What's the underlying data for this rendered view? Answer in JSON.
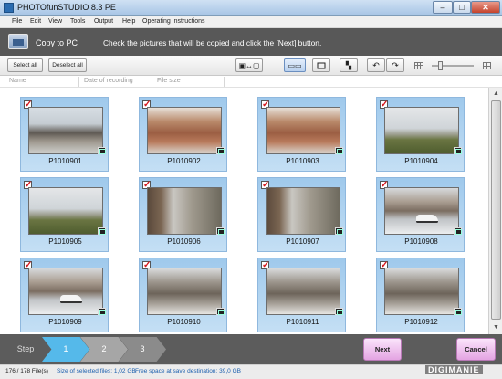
{
  "window": {
    "title": "PHOTOfunSTUDIO 8.3 PE",
    "controls": {
      "minimize": "–",
      "maximize": "□",
      "close": "✕"
    }
  },
  "menu": {
    "items": [
      "File",
      "Edit",
      "View",
      "Tools",
      "Output",
      "Help",
      "Operating Instructions"
    ]
  },
  "header": {
    "title": "Copy to PC",
    "instruction": "Check the pictures that will be copied and click the [Next] button."
  },
  "toolbar": {
    "select_all": "Select all",
    "deselect_all": "Deselect all",
    "icons": [
      "view-toggle-icon",
      "thumbnail-view-icon",
      "single-view-icon",
      "filmstrip-view-icon",
      "rotate-left-icon",
      "rotate-right-icon",
      "small-grid-icon",
      "large-grid-icon"
    ]
  },
  "columns": [
    "Name",
    "Date of recording",
    "File size"
  ],
  "photos": [
    {
      "name": "P1010901",
      "checked": true,
      "style": "lane"
    },
    {
      "name": "P1010902",
      "checked": true,
      "style": "autumn"
    },
    {
      "name": "P1010903",
      "checked": true,
      "style": "autumn"
    },
    {
      "name": "P1010904",
      "checked": true,
      "style": "field"
    },
    {
      "name": "P1010905",
      "checked": true,
      "style": "field"
    },
    {
      "name": "P1010906",
      "checked": true,
      "style": "woodedge"
    },
    {
      "name": "P1010907",
      "checked": true,
      "style": "woodedge"
    },
    {
      "name": "P1010908",
      "checked": true,
      "style": "car"
    },
    {
      "name": "P1010909",
      "checked": true,
      "style": "car"
    },
    {
      "name": "P1010910",
      "checked": true,
      "style": "forest"
    },
    {
      "name": "P1010911",
      "checked": true,
      "style": "forest"
    },
    {
      "name": "P1010912",
      "checked": true,
      "style": "forest"
    }
  ],
  "steps": {
    "label": "Step",
    "items": [
      "1",
      "2",
      "3"
    ],
    "active": "1"
  },
  "actions": {
    "next": "Next",
    "cancel": "Cancel"
  },
  "status": {
    "file_count": "176 / 178 File(s)",
    "selected_size": "Size of selected files: 1,02 GB",
    "free_space": "Free space at save destination: 39,0 GB"
  },
  "watermark": "DIGIMANIE",
  "colors": {
    "header_bg": "#585858",
    "thumb_bg": "#a9d2f0",
    "step_active": "#55b9ea",
    "action_button": "#e4a4e2",
    "check_mark": "#d4161c"
  }
}
